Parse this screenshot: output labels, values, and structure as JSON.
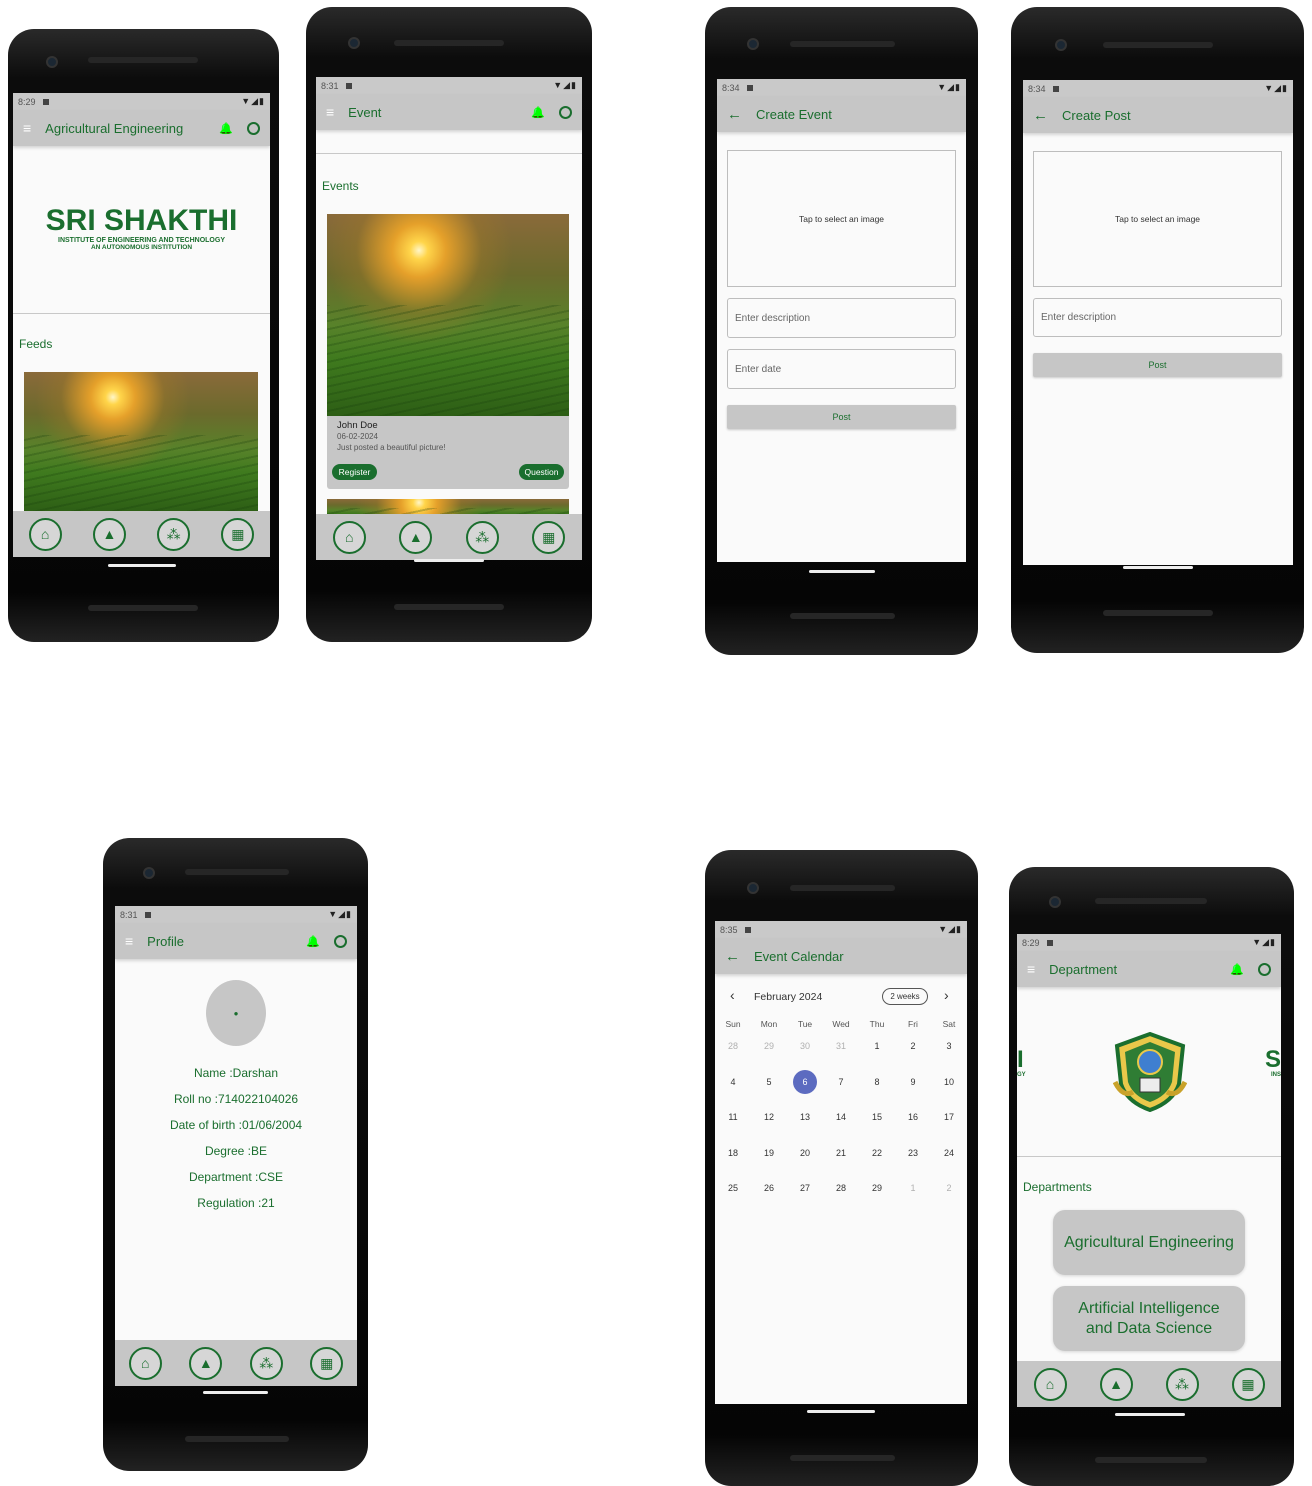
{
  "icons": {
    "menu": "≡",
    "back": "←",
    "bell": "🔔",
    "account": "●",
    "home": "⌂",
    "school": "▲",
    "groups": "⁂",
    "calendar": "▦",
    "person": "●",
    "prev": "‹",
    "next": "›"
  },
  "colors": {
    "primary_green": "#1a6e2e",
    "appbar_gray": "#c6c6c6",
    "today_blue": "#5c6bc0"
  },
  "screen1": {
    "time": "8:29",
    "title": "Agricultural Engineering",
    "logo_main": "SRI SHAKTHI",
    "logo_sub1": "INSTITUTE OF ENGINEERING AND TECHNOLOGY",
    "logo_sub2": "AN AUTONOMOUS INSTITUTION",
    "section": "Feeds"
  },
  "screen2": {
    "time": "8:31",
    "title": "Event",
    "section": "Events",
    "card": {
      "name": "John Doe",
      "date": "06-02-2024",
      "caption": "Just posted a beautiful picture!",
      "register": "Register",
      "question": "Question"
    }
  },
  "screen3": {
    "time": "8:34",
    "title": "Create Event",
    "image_hint": "Tap to select an image",
    "description_placeholder": "Enter description",
    "date_placeholder": "Enter date",
    "post": "Post"
  },
  "screen4": {
    "time": "8:34",
    "title": "Create Post",
    "image_hint": "Tap to select an image",
    "description_placeholder": "Enter description",
    "post": "Post"
  },
  "screen5": {
    "time": "8:31",
    "title": "Profile",
    "lines": [
      "Name :Darshan",
      "Roll no :714022104026",
      "Date of birth :01/06/2004",
      "Degree :BE",
      "Department :CSE",
      "Regulation :21"
    ]
  },
  "screen6": {
    "time": "8:35",
    "title": "Event Calendar",
    "month": "February 2024",
    "format": "2 weeks",
    "weekdays": [
      "Sun",
      "Mon",
      "Tue",
      "Wed",
      "Thu",
      "Fri",
      "Sat"
    ],
    "weeks": [
      [
        "28",
        "29",
        "30",
        "31",
        "1",
        "2",
        "3"
      ],
      [
        "4",
        "5",
        "6",
        "7",
        "8",
        "9",
        "10"
      ],
      [
        "11",
        "12",
        "13",
        "14",
        "15",
        "16",
        "17"
      ],
      [
        "18",
        "19",
        "20",
        "21",
        "22",
        "23",
        "24"
      ],
      [
        "25",
        "26",
        "27",
        "28",
        "29",
        "1",
        "2"
      ]
    ],
    "selected": "6"
  },
  "screen7": {
    "time": "8:29",
    "title": "Department",
    "section": "Departments",
    "departments": [
      "Agricultural Engineering",
      "Artificial Intelligence and Data Science"
    ],
    "logo_edge_left": "I",
    "logo_edge_left_sub": "GY",
    "logo_edge_right": "S",
    "logo_edge_right_sub": "INS"
  }
}
